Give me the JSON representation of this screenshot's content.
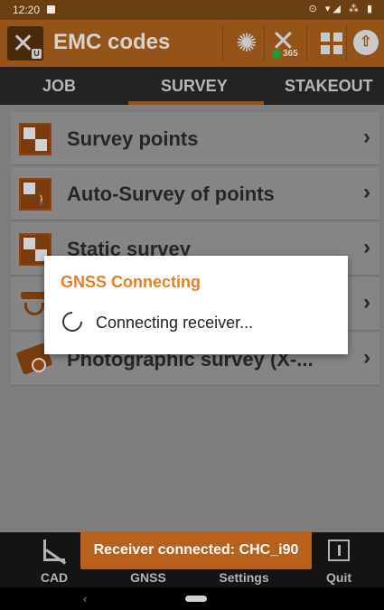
{
  "status_bar": {
    "time": "12:20",
    "sys_icons": "⊙ ▾◢ ⁂ ▮"
  },
  "app": {
    "title": "EMC codes",
    "license_badge": "365"
  },
  "tabs": [
    {
      "label": "JOB"
    },
    {
      "label": "SURVEY",
      "active": true
    },
    {
      "label": "STAKEOUT"
    }
  ],
  "menu": {
    "items": [
      {
        "label": "Survey points",
        "icon": "survey-points-icon"
      },
      {
        "label": "Auto-Survey of points",
        "icon": "auto-survey-icon"
      },
      {
        "label": "Static survey",
        "icon": "static-survey-icon"
      },
      {
        "label": "",
        "icon": "gnss-antenna-icon"
      },
      {
        "label": "Photographic survey (X-...",
        "icon": "camera-icon"
      }
    ],
    "chevron": "›"
  },
  "dialog": {
    "title": "GNSS Connecting",
    "message": "Connecting receiver..."
  },
  "bottom_bar": {
    "items": [
      {
        "label": "CAD"
      },
      {
        "label": "GNSS"
      },
      {
        "label": "Settings"
      },
      {
        "label": "Quit"
      }
    ]
  },
  "toast": {
    "text": "Receiver connected: CHC_i90"
  },
  "nav": {
    "back": "‹"
  },
  "colors": {
    "toolbar": "#945419",
    "accent": "#e67e22",
    "toast": "#b8611d"
  }
}
